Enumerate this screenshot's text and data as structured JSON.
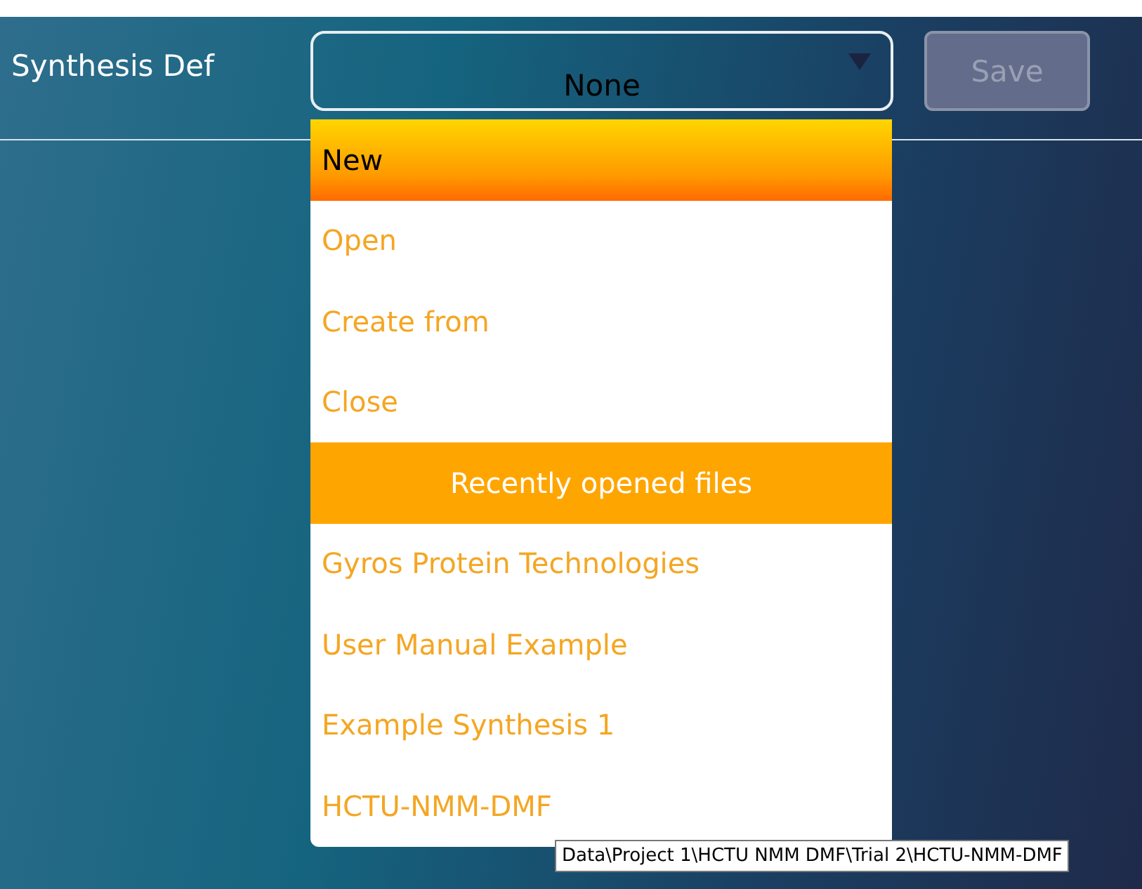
{
  "header": {
    "label": "Synthesis Def",
    "dropdown": {
      "value": "None"
    },
    "save_button": {
      "label": "Save",
      "disabled": true
    }
  },
  "menu": [
    {
      "kind": "item",
      "label": "New",
      "selected": true
    },
    {
      "kind": "item",
      "label": "Open",
      "selected": false
    },
    {
      "kind": "item",
      "label": "Create from",
      "selected": false
    },
    {
      "kind": "item",
      "label": "Close",
      "selected": false
    },
    {
      "kind": "header",
      "label": "Recently opened files"
    },
    {
      "kind": "item",
      "label": "Gyros Protein Technologies",
      "selected": false
    },
    {
      "kind": "item",
      "label": "User Manual Example",
      "selected": false
    },
    {
      "kind": "item",
      "label": "Example Synthesis 1",
      "selected": false
    },
    {
      "kind": "item",
      "label": "HCTU-NMM-DMF",
      "selected": false
    }
  ],
  "tooltip": "Data\\Project 1\\HCTU NMM DMF\\Trial 2\\HCTU-NMM-DMF"
}
